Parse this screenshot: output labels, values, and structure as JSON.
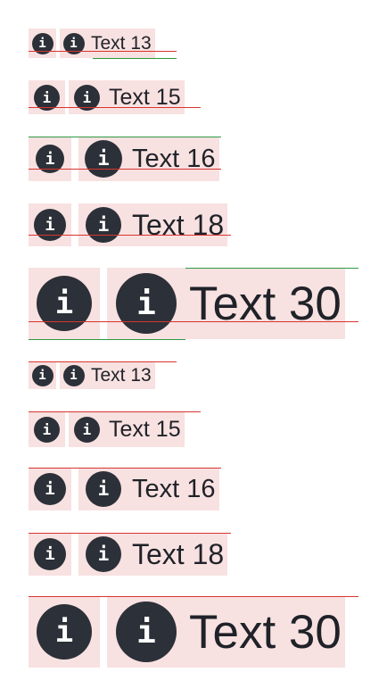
{
  "icon_glyph": "i",
  "icon_name": "info-icon",
  "colors": {
    "icon_fill": "#2c3038",
    "box_bg": "#f8e1e1",
    "red_guide": "#d7352f",
    "green_guide": "#2e9a42"
  },
  "rows": [
    {
      "label": "Text 13"
    },
    {
      "label": "Text 15"
    },
    {
      "label": "Text 16"
    },
    {
      "label": "Text 18"
    },
    {
      "label": "Text 30"
    },
    {
      "label": "Text 13"
    },
    {
      "label": "Text 15"
    },
    {
      "label": "Text 16"
    },
    {
      "label": "Text 18"
    },
    {
      "label": "Text 30"
    }
  ]
}
